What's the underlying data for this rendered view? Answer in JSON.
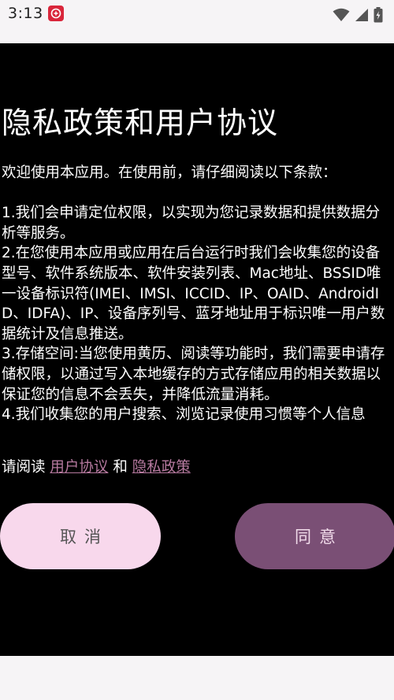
{
  "status_bar": {
    "time": "3:13",
    "icons": [
      "app-badge-icon",
      "wifi-icon",
      "signal-icon",
      "battery-charging-icon"
    ]
  },
  "dialog": {
    "title": "隐私政策和用户协议",
    "intro": "欢迎使用本应用。在使用前，请仔细阅读以下条款：",
    "terms": [
      "1.我们会申请定位权限，以实现为您记录数据和提供数据分析等服务。",
      "2.在您使用本应用或应用在后台运行时我们会收集您的设备型号、软件系统版本、软件安装列表、Mac地址、BSSID唯一设备标识符(IMEI、IMSI、ICCID、IP、OAID、AndroidID、IDFA)、IP、设备序列号、蓝牙地址用于标识唯一用户数据统计及信息推送。",
      "3.存储空间:当您使用黄历、阅读等功能时，我们需要申请存储权限，以通过写入本地缓存的方式存储应用的相关数据以保证您的信息不会丢失，并降低流量消耗。",
      "4.我们收集您的用户搜索、浏览记录使用习惯等个人信息"
    ],
    "read_prefix": "请阅读",
    "user_agreement_link": "用户协议",
    "and_text": "和",
    "privacy_policy_link": "隐私政策",
    "cancel_label": "取消",
    "agree_label": "同意"
  },
  "colors": {
    "dialog_background": "#000000",
    "link": "#b77aa0",
    "cancel_button": "#f8d8ec",
    "agree_button": "#7a4f75",
    "status_bar": "#f6f4f6"
  }
}
